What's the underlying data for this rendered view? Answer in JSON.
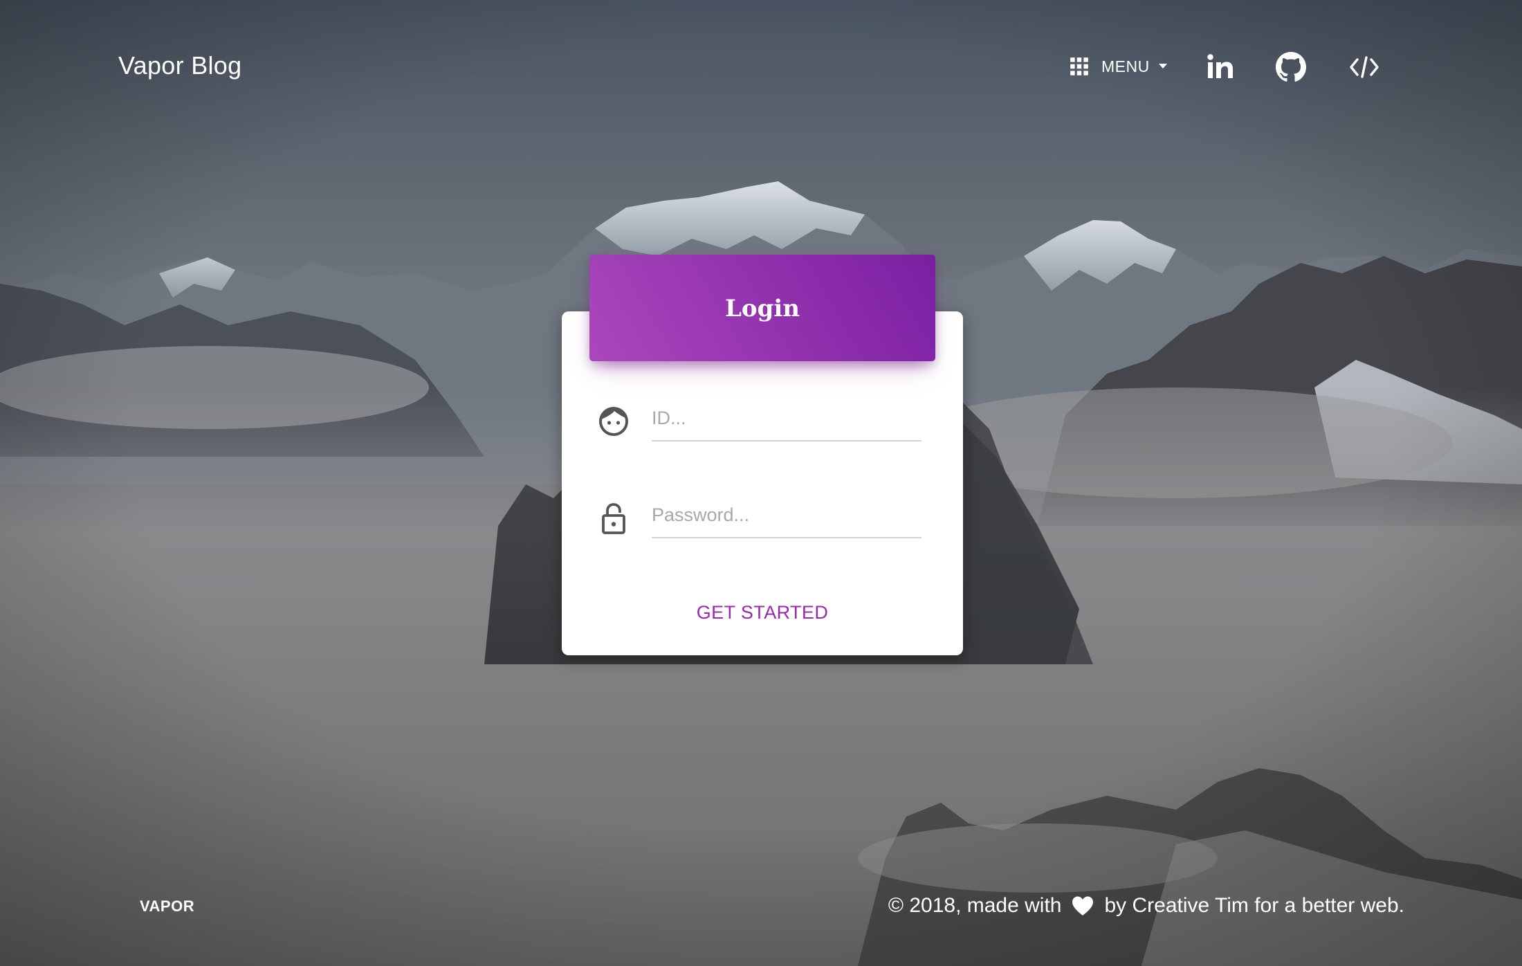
{
  "header": {
    "brand": "Vapor Blog",
    "menu_label": "MENU",
    "icons": [
      "grid-icon",
      "linkedin-icon",
      "github-icon",
      "code-icon"
    ]
  },
  "login_card": {
    "title": "Login",
    "id_field": {
      "placeholder": "ID...",
      "value": "",
      "icon": "face-icon"
    },
    "password_field": {
      "placeholder": "Password...",
      "value": "",
      "icon": "lock-icon"
    },
    "cta_label": "GET STARTED"
  },
  "footer": {
    "left_label": "VAPOR",
    "copyright_before": "© 2018, made with",
    "copyright_after": "by Creative Tim for a better web.",
    "heart_icon": "heart-icon"
  },
  "colors": {
    "accent": "#9c27b0",
    "header_gradient_start": "#ab47bc",
    "header_gradient_end": "#7b1fa2",
    "card_bg": "#ffffff",
    "text_on_dark": "#ffffff"
  }
}
